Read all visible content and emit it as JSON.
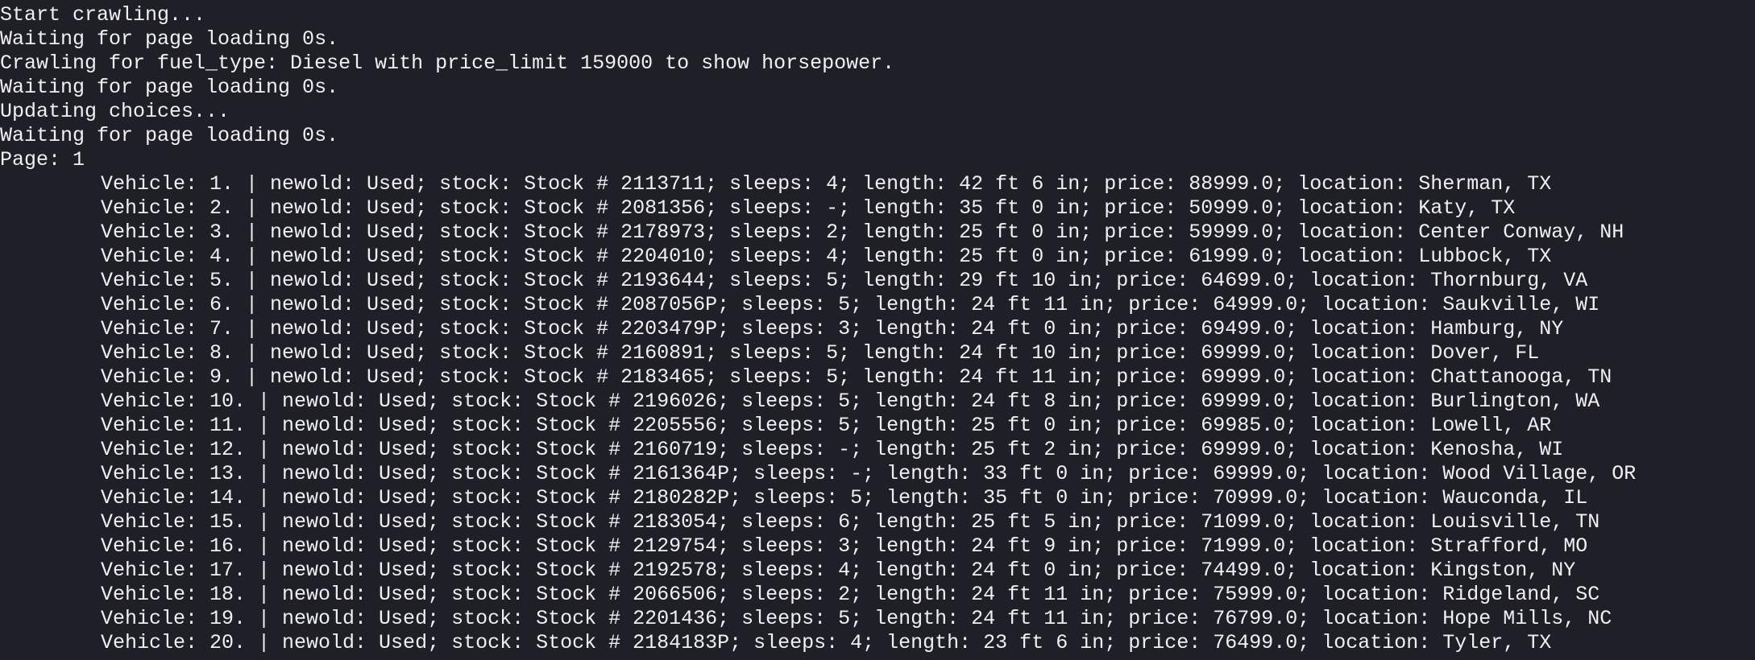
{
  "terminal": {
    "background": "#1f1f27",
    "foreground": "#f0f0f2",
    "log_lines": [
      "Start crawling...",
      "Waiting for page loading 0s.",
      "Crawling for fuel_type: Diesel with price_limit 159000 to show horsepower.",
      "Waiting for page loading 0s.",
      "Updating choices...",
      "Waiting for page loading 0s.",
      "Page: 1"
    ],
    "vehicles": [
      "Vehicle: 1. | newold: Used; stock: Stock # 2113711; sleeps: 4; length: 42 ft 6 in; price: 88999.0; location: Sherman, TX",
      "Vehicle: 2. | newold: Used; stock: Stock # 2081356; sleeps: -; length: 35 ft 0 in; price: 50999.0; location: Katy, TX",
      "Vehicle: 3. | newold: Used; stock: Stock # 2178973; sleeps: 2; length: 25 ft 0 in; price: 59999.0; location: Center Conway, NH",
      "Vehicle: 4. | newold: Used; stock: Stock # 2204010; sleeps: 4; length: 25 ft 0 in; price: 61999.0; location: Lubbock, TX",
      "Vehicle: 5. | newold: Used; stock: Stock # 2193644; sleeps: 5; length: 29 ft 10 in; price: 64699.0; location: Thornburg, VA",
      "Vehicle: 6. | newold: Used; stock: Stock # 2087056P; sleeps: 5; length: 24 ft 11 in; price: 64999.0; location: Saukville, WI",
      "Vehicle: 7. | newold: Used; stock: Stock # 2203479P; sleeps: 3; length: 24 ft 0 in; price: 69499.0; location: Hamburg, NY",
      "Vehicle: 8. | newold: Used; stock: Stock # 2160891; sleeps: 5; length: 24 ft 10 in; price: 69999.0; location: Dover, FL",
      "Vehicle: 9. | newold: Used; stock: Stock # 2183465; sleeps: 5; length: 24 ft 11 in; price: 69999.0; location: Chattanooga, TN",
      "Vehicle: 10. | newold: Used; stock: Stock # 2196026; sleeps: 5; length: 24 ft 8 in; price: 69999.0; location: Burlington, WA",
      "Vehicle: 11. | newold: Used; stock: Stock # 2205556; sleeps: 5; length: 25 ft 0 in; price: 69985.0; location: Lowell, AR",
      "Vehicle: 12. | newold: Used; stock: Stock # 2160719; sleeps: -; length: 25 ft 2 in; price: 69999.0; location: Kenosha, WI",
      "Vehicle: 13. | newold: Used; stock: Stock # 2161364P; sleeps: -; length: 33 ft 0 in; price: 69999.0; location: Wood Village, OR",
      "Vehicle: 14. | newold: Used; stock: Stock # 2180282P; sleeps: 5; length: 35 ft 0 in; price: 70999.0; location: Wauconda, IL",
      "Vehicle: 15. | newold: Used; stock: Stock # 2183054; sleeps: 6; length: 25 ft 5 in; price: 71099.0; location: Louisville, TN",
      "Vehicle: 16. | newold: Used; stock: Stock # 2129754; sleeps: 3; length: 24 ft 9 in; price: 71999.0; location: Strafford, MO",
      "Vehicle: 17. | newold: Used; stock: Stock # 2192578; sleeps: 4; length: 24 ft 0 in; price: 74499.0; location: Kingston, NY",
      "Vehicle: 18. | newold: Used; stock: Stock # 2066506; sleeps: 2; length: 24 ft 11 in; price: 75999.0; location: Ridgeland, SC",
      "Vehicle: 19. | newold: Used; stock: Stock # 2201436; sleeps: 5; length: 24 ft 11 in; price: 76799.0; location: Hope Mills, NC",
      "Vehicle: 20. | newold: Used; stock: Stock # 2184183P; sleeps: 4; length: 23 ft 6 in; price: 76499.0; location: Tyler, TX"
    ]
  }
}
